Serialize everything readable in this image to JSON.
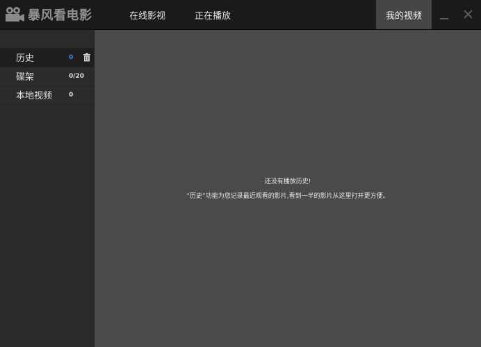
{
  "app": {
    "brand": "暴风看电影"
  },
  "nav": {
    "tabs": [
      "在线影视",
      "正在播放"
    ],
    "active_tab": "我的视频"
  },
  "sidebar": {
    "items": [
      {
        "label": "历史",
        "count": "0"
      },
      {
        "label": "碟架",
        "count": "0/20"
      },
      {
        "label": "本地视频",
        "count": "0"
      }
    ]
  },
  "main": {
    "empty_title": "还没有播放历史!",
    "empty_desc": "“历史”功能为您记录最近观看的影片,看到一半的影片从这里打开更方便。"
  },
  "colors": {
    "titlebar": "#1a1a1a",
    "sidebar": "#2b2b2b",
    "content": "#4a4a4a",
    "accent_count": "#3d8de0"
  },
  "icons": [
    "film-camera-icon",
    "minimize-icon",
    "close-icon",
    "trash-icon"
  ]
}
